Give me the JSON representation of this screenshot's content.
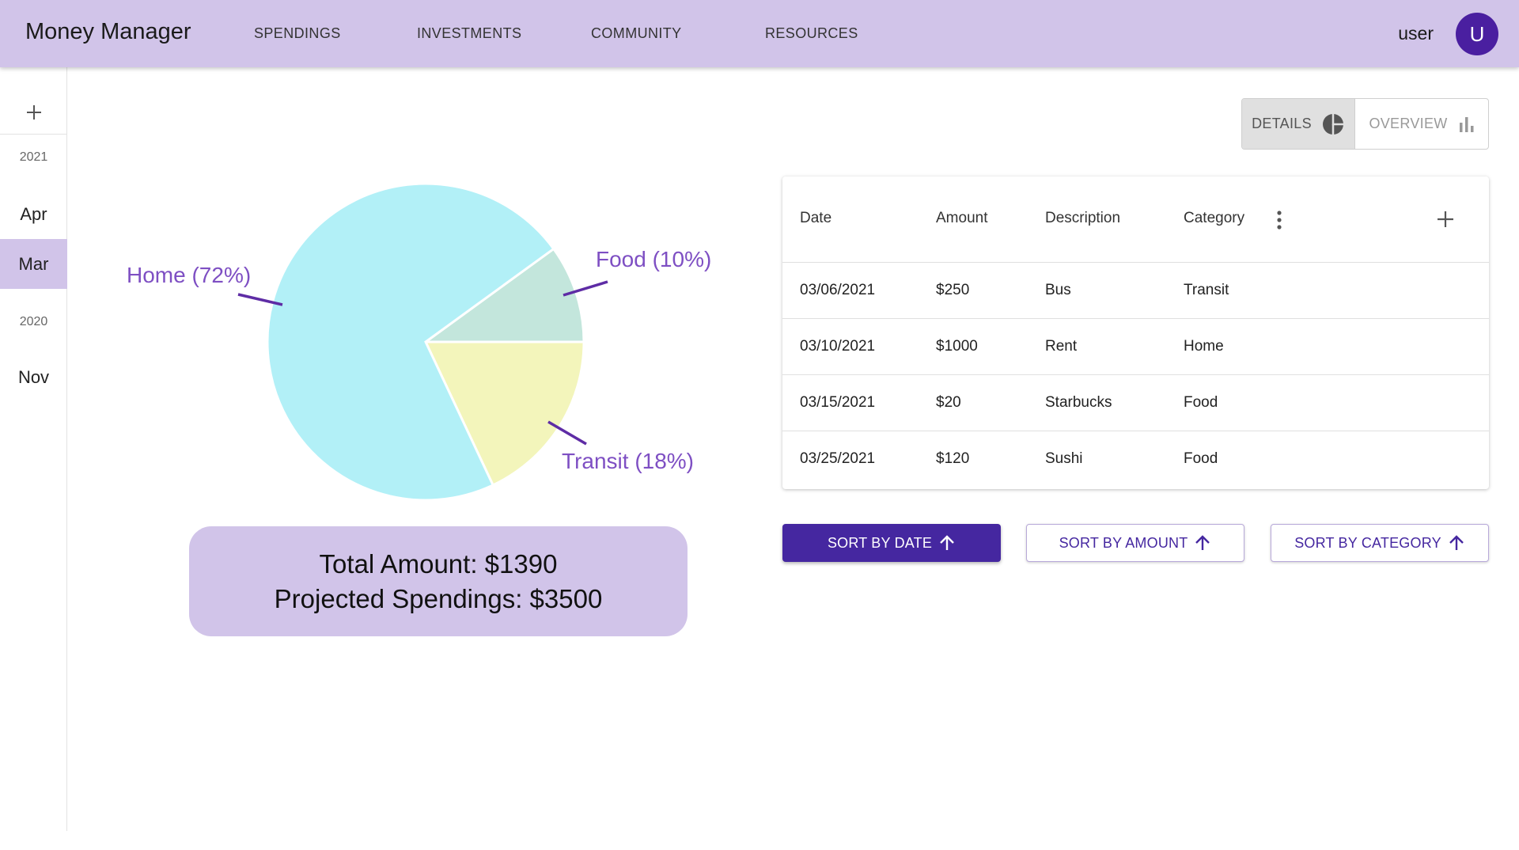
{
  "app": {
    "title": "Money Manager"
  },
  "nav": {
    "items": [
      {
        "label": "SPENDINGS"
      },
      {
        "label": "INVESTMENTS"
      },
      {
        "label": "COMMUNITY"
      },
      {
        "label": "RESOURCES"
      }
    ]
  },
  "user": {
    "name": "user",
    "avatar_letter": "U"
  },
  "rail": {
    "add_icon": "plus-icon",
    "groups": [
      {
        "year": "2021",
        "months": [
          "Apr",
          "Mar"
        ]
      },
      {
        "year": "2020",
        "months": [
          "Nov"
        ]
      }
    ],
    "selected_month": "Mar"
  },
  "view_toggle": {
    "details_label": "DETAILS",
    "details_icon": "pie-chart-icon",
    "overview_label": "OVERVIEW",
    "overview_icon": "bar-chart-icon",
    "selected": "DETAILS"
  },
  "chart_data": {
    "type": "pie",
    "slices": [
      {
        "label": "Home (72%)",
        "category": "Home",
        "value": 72,
        "color": "#b2f0f7"
      },
      {
        "label": "Food (10%)",
        "category": "Food",
        "value": 10,
        "color": "#c3e6dc"
      },
      {
        "label": "Transit (18%)",
        "category": "Transit",
        "value": 18,
        "color": "#f3f5bb"
      }
    ],
    "label_color": "#7e4fc3",
    "leader_color": "#5e2ca5"
  },
  "summary": {
    "total_line": "Total Amount: $1390",
    "projected_line": "Projected Spendings: $3500"
  },
  "table": {
    "headers": {
      "date": "Date",
      "amount": "Amount",
      "description": "Description",
      "category": "Category"
    },
    "menu_icon": "more-vertical-icon",
    "add_icon": "plus-icon",
    "rows": [
      {
        "date": "03/06/2021",
        "amount": "$250",
        "description": "Bus",
        "category": "Transit"
      },
      {
        "date": "03/10/2021",
        "amount": "$1000",
        "description": "Rent",
        "category": "Home"
      },
      {
        "date": "03/15/2021",
        "amount": "$20",
        "description": "Starbucks",
        "category": "Food"
      },
      {
        "date": "03/25/2021",
        "amount": "$120",
        "description": "Sushi",
        "category": "Food"
      }
    ]
  },
  "sort": {
    "by_date": "SORT BY DATE",
    "by_amount": "SORT BY AMOUNT",
    "by_category": "SORT BY CATEGORY",
    "arrow_icon": "arrow-up-icon",
    "active": "SORT BY DATE"
  },
  "colors": {
    "accent": "#4527a0",
    "lavender": "#d1c4e9",
    "avatar": "#4a1fa0"
  }
}
